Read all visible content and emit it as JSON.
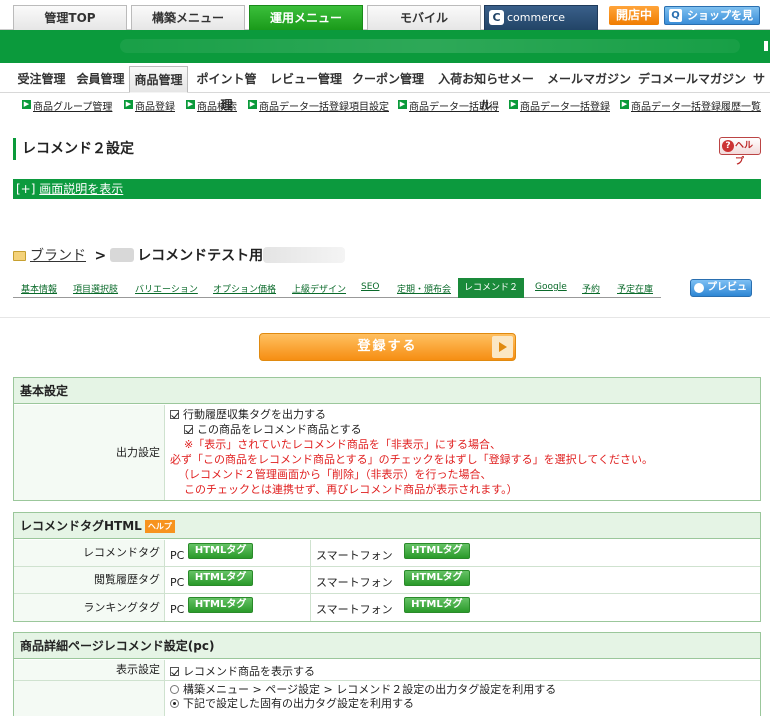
{
  "top_tabs": [
    {
      "label": "管理TOP"
    },
    {
      "label": "構築メニュー"
    },
    {
      "label": "運用メニュー"
    },
    {
      "label": "モバイル"
    },
    {
      "label": "commerce creator"
    }
  ],
  "top_right": {
    "open_badge": "開店中",
    "shop_button": "ショップを見る"
  },
  "sub_nav": [
    "受注管理",
    "会員管理",
    "商品管理",
    "ポイント管理",
    "レビュー管理",
    "クーポン管理",
    "入荷お知らせメール",
    "メールマガジン",
    "デコメールマガジン",
    "サ"
  ],
  "sub_sub_nav": [
    "商品グループ管理",
    "商品登録",
    "商品検索",
    "商品データ一括登録項目設定",
    "商品データ一括取得",
    "商品データ一括登録",
    "商品データ一括登録履歴一覧"
  ],
  "page": {
    "title": "レコメンド２設定",
    "help": "ヘルプ",
    "desc_prefix": "[+]",
    "desc_link": "画面説明を表示"
  },
  "breadcrumb": {
    "link": "ブランド",
    "sep": ">",
    "item": "レコメンドテスト用"
  },
  "edit_tabs": [
    "基本情報",
    "項目選択肢",
    "バリエーション",
    "オプション価格",
    "上級デザイン",
    "SEO",
    "定期・頒布会",
    "レコメンド２",
    "Google",
    "予約",
    "予定在庫"
  ],
  "preview_button": "プレビュー",
  "register_button": "登録する",
  "basic": {
    "heading": "基本設定",
    "output_label": "出力設定",
    "check1": "行動履歴収集タグを出力する",
    "check2": "この商品をレコメンド商品とする",
    "notes": [
      "※「表示」されていたレコメンド商品を「非表示」にする場合、",
      "必ず「この商品をレコメンド商品とする」のチェックをはずし「登録する」を選択してください。",
      "（レコメンド２管理画面から「削除」（非表示）を行った場合、",
      "このチェックとは連携せず、再びレコメンド商品が表示されます。）"
    ]
  },
  "tag_html": {
    "heading": "レコメンドタグHTML",
    "help": "ヘルプ",
    "rows": [
      {
        "label": "レコメンドタグ",
        "pc": "PC",
        "pc_btn": "HTMLタグ",
        "sp": "スマートフォン",
        "sp_btn": "HTMLタグ"
      },
      {
        "label": "閲覧履歴タグ",
        "pc": "PC",
        "pc_btn": "HTMLタグ",
        "sp": "スマートフォン",
        "sp_btn": "HTMLタグ"
      },
      {
        "label": "ランキングタグ",
        "pc": "PC",
        "pc_btn": "HTMLタグ",
        "sp": "スマートフォン",
        "sp_btn": "HTMLタグ"
      }
    ]
  },
  "detail_pc": {
    "heading": "商品詳細ページレコメンド設定(pc)",
    "display_label": "表示設定",
    "display_check": "レコメンド商品を表示する",
    "radio1": "構築メニュー > ページ設定 > レコメンド２設定の出力タグ設定を利用する",
    "radio2": "下記で設定した固有の出力タグ設定を利用する"
  }
}
